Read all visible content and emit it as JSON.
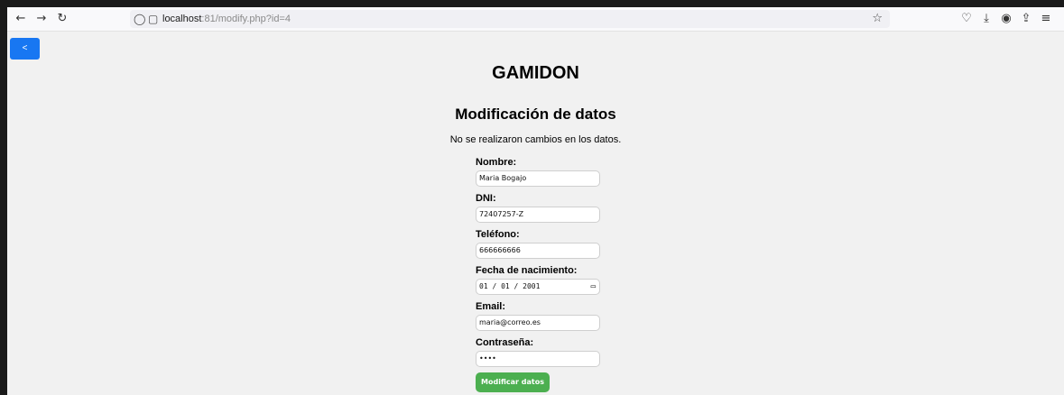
{
  "browser": {
    "url_host": "localhost",
    "url_path": ":81/modify.php?id=4",
    "icons": [
      "back-arrow-icon",
      "forward-arrow-icon",
      "reload-icon",
      "shield-icon",
      "page-icon",
      "star-icon",
      "pocket-icon",
      "download-icon",
      "extension-icon",
      "share-icon",
      "menu-icon"
    ]
  },
  "page": {
    "back_label": "<",
    "site_title": "GAMIDON",
    "section_title": "Modificación de datos",
    "message": "No se realizaron cambios en los datos.",
    "submit_label": "Modificar datos"
  },
  "form": {
    "nombre": {
      "label": "Nombre:",
      "value": "Maria Bogajo"
    },
    "dni": {
      "label": "DNI:",
      "value": "72407257-Z"
    },
    "telefono": {
      "label": "Teléfono:",
      "value": "666666666"
    },
    "fecha": {
      "label": "Fecha de nacimiento:",
      "value": "01 / 01 / 2001"
    },
    "email": {
      "label": "Email:",
      "value": "maria@correo.es"
    },
    "password": {
      "label": "Contraseña:",
      "value": "••••"
    }
  },
  "colors": {
    "back_button": "#1877f2",
    "submit_button": "#4caf50",
    "page_bg": "#f1f1f1"
  }
}
